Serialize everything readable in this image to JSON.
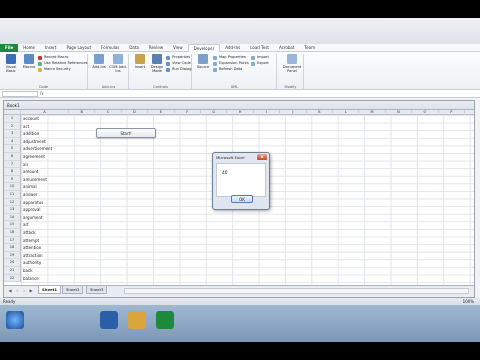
{
  "ribbon_tabs": [
    "File",
    "Home",
    "Insert",
    "Page Layout",
    "Formulas",
    "Data",
    "Review",
    "View",
    "Developer",
    "Add-Ins",
    "Load Test",
    "Acrobat",
    "Team"
  ],
  "ribbon": {
    "code_group": "Code",
    "visual_basic": "Visual Basic",
    "macros": "Macros",
    "record_macro": "Record Macro",
    "relative_refs": "Use Relative References",
    "macro_security": "Macro Security",
    "addins_group": "Add-Ins",
    "addins": "Add-Ins",
    "com_addins": "COM Add-Ins",
    "controls_group": "Controls",
    "insert": "Insert",
    "design_mode": "Design Mode",
    "properties": "Properties",
    "view_code": "View Code",
    "run_dialog": "Run Dialog",
    "xml_group": "XML",
    "source": "Source",
    "map_properties": "Map Properties",
    "expansion_packs": "Expansion Packs",
    "refresh_data": "Refresh Data",
    "import": "Import",
    "export": "Export",
    "modify_group": "Modify",
    "document_panel": "Document Panel"
  },
  "workbook": {
    "title": "Book1"
  },
  "columns": [
    "A",
    "B",
    "C",
    "D",
    "E",
    "F",
    "G",
    "H",
    "I",
    "J",
    "K",
    "L",
    "M",
    "N",
    "O",
    "P",
    "Q"
  ],
  "rows": [
    {
      "num": "1",
      "word": "account"
    },
    {
      "num": "2",
      "word": "act"
    },
    {
      "num": "3",
      "word": "addition"
    },
    {
      "num": "4",
      "word": "adjustment"
    },
    {
      "num": "5",
      "word": "advertisement"
    },
    {
      "num": "6",
      "word": "agreement"
    },
    {
      "num": "7",
      "word": "air"
    },
    {
      "num": "8",
      "word": "amount"
    },
    {
      "num": "9",
      "word": "amusement"
    },
    {
      "num": "10",
      "word": "animal"
    },
    {
      "num": "11",
      "word": "answer"
    },
    {
      "num": "12",
      "word": "apparatus"
    },
    {
      "num": "13",
      "word": "approval"
    },
    {
      "num": "14",
      "word": "argument"
    },
    {
      "num": "15",
      "word": "art"
    },
    {
      "num": "16",
      "word": "attack"
    },
    {
      "num": "17",
      "word": "attempt"
    },
    {
      "num": "18",
      "word": "attention"
    },
    {
      "num": "19",
      "word": "attraction"
    },
    {
      "num": "20",
      "word": "authority"
    },
    {
      "num": "21",
      "word": "back"
    },
    {
      "num": "22",
      "word": "balance"
    }
  ],
  "start_button": "Start!",
  "sheets": [
    "Sheet1",
    "Sheet2",
    "Sheet3"
  ],
  "status": {
    "ready": "Ready",
    "zoom": "100%"
  },
  "dialog": {
    "title": "Microsoft Excel",
    "message": "40",
    "ok": "OK",
    "close": "x"
  },
  "colors": {
    "file_tab": "#1d8a3c",
    "taskbar": "#7d97b7"
  }
}
